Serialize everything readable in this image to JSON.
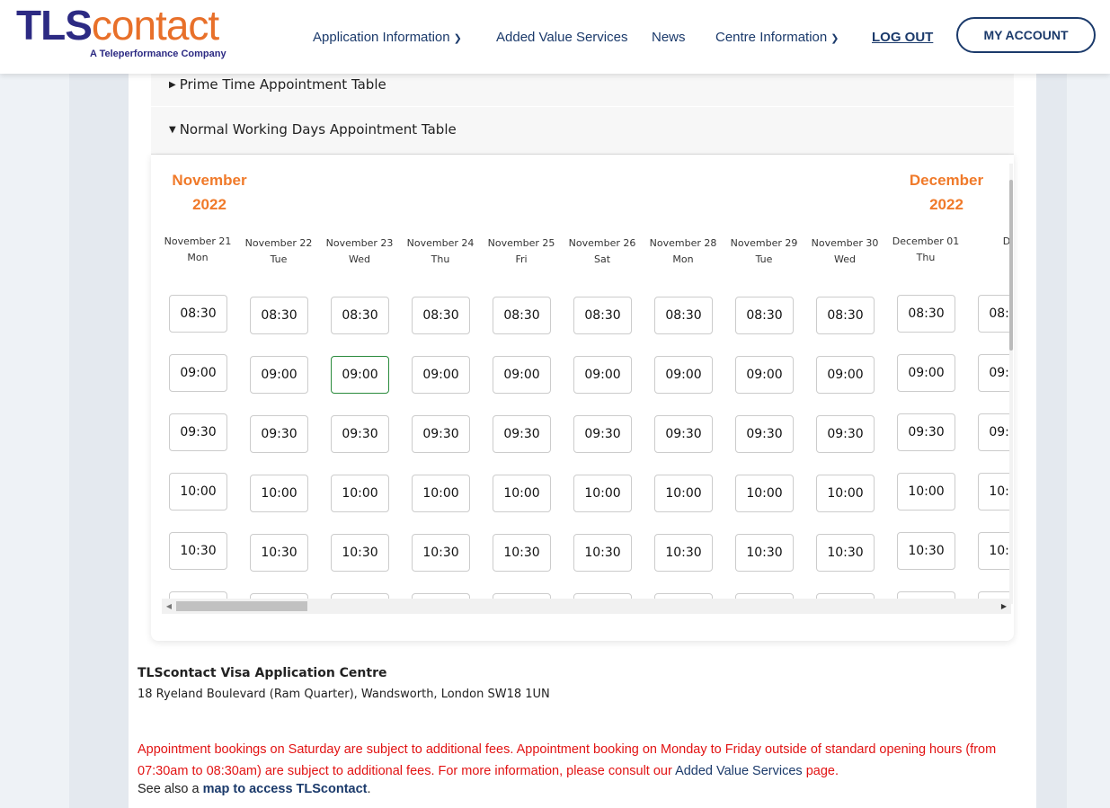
{
  "header": {
    "logo_tls": "TLS",
    "logo_contact": "contact",
    "logo_tagline": "A Teleperformance Company",
    "nav": {
      "application_information": "Application Information",
      "added_value_services": "Added Value Services",
      "news": "News",
      "centre_information": "Centre Information",
      "log_out": "LOG OUT"
    },
    "my_account": "MY ACCOUNT"
  },
  "accordions": {
    "prime_time": "Prime Time Appointment Table",
    "normal_days": "Normal Working Days Appointment Table"
  },
  "months": [
    {
      "month": "November",
      "year": "2022"
    },
    {
      "month": "December",
      "year": "2022"
    }
  ],
  "days": [
    {
      "date": "November 21",
      "weekday": "Mon"
    },
    {
      "date": "November 22",
      "weekday": "Tue"
    },
    {
      "date": "November 23",
      "weekday": "Wed"
    },
    {
      "date": "November 24",
      "weekday": "Thu"
    },
    {
      "date": "November 25",
      "weekday": "Fri"
    },
    {
      "date": "November 26",
      "weekday": "Sat"
    },
    {
      "date": "November 28",
      "weekday": "Mon"
    },
    {
      "date": "November 29",
      "weekday": "Tue"
    },
    {
      "date": "November 30",
      "weekday": "Wed"
    },
    {
      "date": "December 01",
      "weekday": "Thu"
    },
    {
      "date": "D",
      "weekday": ""
    }
  ],
  "time_slots": [
    "08:30",
    "09:00",
    "09:30",
    "10:00",
    "10:30",
    ""
  ],
  "selected_slot": {
    "day_index": 2,
    "slot_index": 1
  },
  "colors": {
    "brand_blue": "#2c2a83",
    "brand_orange": "#e8702a",
    "notice_red": "#e21313",
    "selected_border": "#2a8a3c"
  },
  "centre": {
    "name": "TLScontact Visa Application Centre",
    "address": "18 Ryeland Boulevard (Ram Quarter), Wandsworth, London SW18 1UN"
  },
  "notice": {
    "text": "Appointment bookings on Saturday are subject to additional fees. Appointment booking on Monday to Friday outside of standard opening hours (from 07:30am to 08:30am) are subject to additional fees. For more information, please consult our",
    "link": "Added Value Services",
    "suffix": "page."
  },
  "see_also": {
    "prefix": "See also a",
    "link": "map to access TLScontact",
    "suffix": "."
  }
}
